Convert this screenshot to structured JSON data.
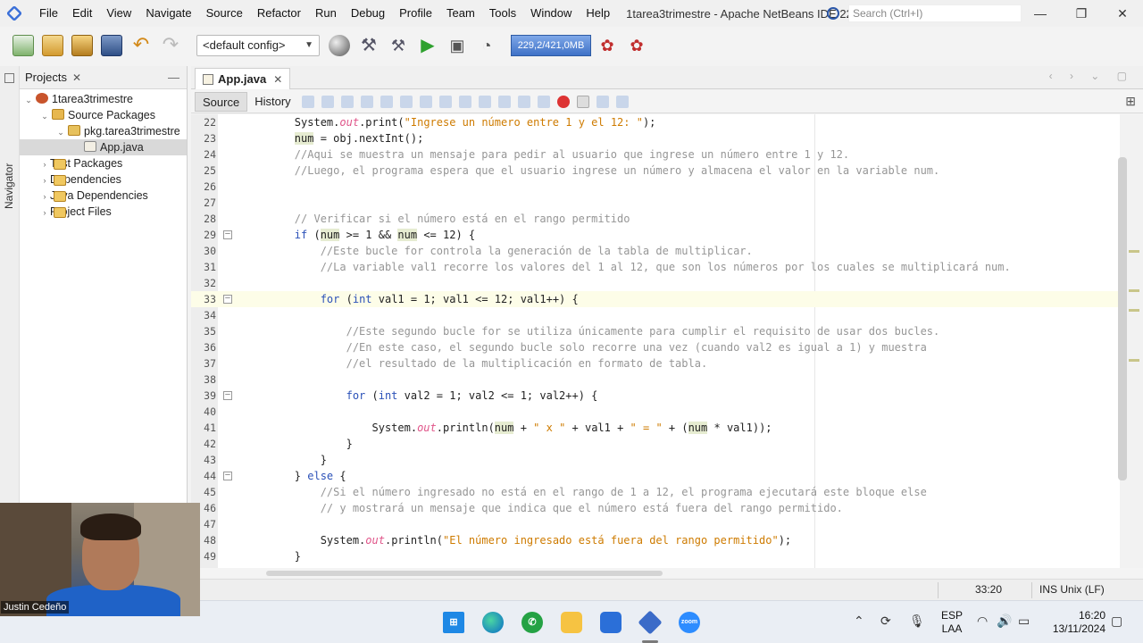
{
  "menu": [
    "File",
    "Edit",
    "View",
    "Navigate",
    "Source",
    "Refactor",
    "Run",
    "Debug",
    "Profile",
    "Team",
    "Tools",
    "Window",
    "Help"
  ],
  "window_title": "1tarea3trimestre - Apache NetBeans IDE 22",
  "search_placeholder": "Search (Ctrl+I)",
  "toolbar": {
    "config": "<default config>",
    "memory": "229,2/421,0MB"
  },
  "projects_tab": "Projects",
  "navigator_label": "Navigator",
  "tree": [
    {
      "label": "1tarea3trimestre",
      "icon": "project-icon",
      "depth": 0,
      "twisty": "open"
    },
    {
      "label": "Source Packages",
      "icon": "source-packages-icon",
      "depth": 1,
      "twisty": "open"
    },
    {
      "label": "pkg.tarea3trimestre",
      "icon": "package-icon",
      "depth": 2,
      "twisty": "open"
    },
    {
      "label": "App.java",
      "icon": "java-file-icon",
      "depth": 3,
      "twisty": "",
      "selected": true
    },
    {
      "label": "Test Packages",
      "icon": "folder-icon",
      "depth": 1,
      "twisty": "closed"
    },
    {
      "label": "Dependencies",
      "icon": "folder-icon",
      "depth": 1,
      "twisty": "closed"
    },
    {
      "label": "Java Dependencies",
      "icon": "folder-icon",
      "depth": 1,
      "twisty": "closed"
    },
    {
      "label": "Project Files",
      "icon": "folder-icon",
      "depth": 1,
      "twisty": "closed"
    }
  ],
  "editor_tab": "App.java",
  "source_tab": "Source",
  "history_tab": "History",
  "code": [
    {
      "n": "22",
      "t": "        System.out.print(\"Ingrese un número entre 1 y el 12: \");"
    },
    {
      "n": "23",
      "t": "        num = obj.nextInt();"
    },
    {
      "n": "24",
      "t": "        //Aqui se muestra un mensaje para pedir al usuario que ingrese un número entre 1 y 12."
    },
    {
      "n": "25",
      "t": "        //Luego, el programa espera que el usuario ingrese un número y almacena el valor en la variable num."
    },
    {
      "n": "26",
      "t": ""
    },
    {
      "n": "27",
      "t": ""
    },
    {
      "n": "28",
      "t": "        // Verificar si el número está en el rango permitido"
    },
    {
      "n": "29",
      "t": "        if (num >= 1 && num <= 12) {",
      "fold": true
    },
    {
      "n": "30",
      "t": "            //Este bucle for controla la generación de la tabla de multiplicar."
    },
    {
      "n": "31",
      "t": "            //La variable val1 recorre los valores del 1 al 12, que son los números por los cuales se multiplicará num."
    },
    {
      "n": "32",
      "t": ""
    },
    {
      "n": "33",
      "t": "            for (int val1 = 1; val1 <= 12; val1++) {",
      "fold": true,
      "current": true
    },
    {
      "n": "34",
      "t": ""
    },
    {
      "n": "35",
      "t": "                //Este segundo bucle for se utiliza únicamente para cumplir el requisito de usar dos bucles."
    },
    {
      "n": "36",
      "t": "                //En este caso, el segundo bucle solo recorre una vez (cuando val2 es igual a 1) y muestra"
    },
    {
      "n": "37",
      "t": "                //el resultado de la multiplicación en formato de tabla."
    },
    {
      "n": "38",
      "t": ""
    },
    {
      "n": "39",
      "t": "                for (int val2 = 1; val2 <= 1; val2++) {",
      "fold": true
    },
    {
      "n": "40",
      "t": ""
    },
    {
      "n": "41",
      "t": "                    System.out.println(num + \" x \" + val1 + \" = \" + (num * val1));"
    },
    {
      "n": "42",
      "t": "                }"
    },
    {
      "n": "43",
      "t": "            }"
    },
    {
      "n": "44",
      "t": "        } else {",
      "fold": true
    },
    {
      "n": "45",
      "t": "            //Si el número ingresado no está en el rango de 1 a 12, el programa ejecutará este bloque else"
    },
    {
      "n": "46",
      "t": "            // y mostrará un mensaje que indica que el número está fuera del rango permitido."
    },
    {
      "n": "47",
      "t": ""
    },
    {
      "n": "48",
      "t": "            System.out.println(\"El número ingresado está fuera del rango permitido\");"
    },
    {
      "n": "49",
      "t": "        }"
    }
  ],
  "status": {
    "position": "33:20",
    "mode": "INS",
    "line_ending": "Unix (LF)"
  },
  "webcam_name": "Justin Cedeño",
  "taskbar": {
    "lang_1": "ESP",
    "lang_2": "LAA",
    "time": "16:20",
    "date": "13/11/2024",
    "zoom_label": "zoom"
  }
}
